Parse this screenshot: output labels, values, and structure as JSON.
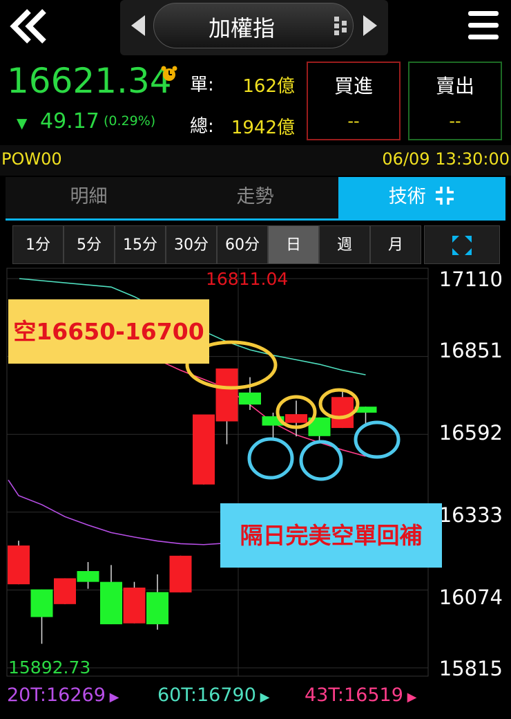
{
  "header": {
    "title": "加權指",
    "icons": [
      "double-back-chevron-icon",
      "prev-triangle-icon",
      "grid-dots-icon",
      "next-triangle-icon",
      "hamburger-menu-icon"
    ]
  },
  "quote": {
    "price": "16621.34",
    "change_arrow": "▼",
    "change": "49.17",
    "change_pct": "(0.29%)",
    "single_label": "單:",
    "single_value": "162億",
    "total_label": "總:",
    "total_value": "1942億",
    "buy_label": "買進",
    "buy_value": "--",
    "sell_label": "賣出",
    "sell_value": "--",
    "colors": {
      "up": "#e3141e",
      "down": "#2bd943",
      "accent": "#0ab4ee",
      "value_yellow": "#f0e020"
    }
  },
  "info": {
    "code": "POW00",
    "datetime": "06/09 13:30:00"
  },
  "tabs": [
    {
      "label": "明細"
    },
    {
      "label": "走勢"
    },
    {
      "label": "技術"
    }
  ],
  "periods": [
    "1分",
    "5分",
    "15分",
    "30分",
    "60分",
    "日",
    "週",
    "月"
  ],
  "selected_period": "日",
  "chart": {
    "high_label": "16811.04",
    "low_label": "15892.73",
    "y_ticks": [
      "17110",
      "16851",
      "16592",
      "16333",
      "16074",
      "15815"
    ],
    "note_short": "空16650-16700",
    "note_cover": "隔日完美空單回補",
    "ma": [
      {
        "label": "20T:16269",
        "color": "#b84fe8"
      },
      {
        "label": "60T:16790",
        "color": "#4fe0c0"
      },
      {
        "label": "43T:16519",
        "color": "#ff3d8a"
      }
    ]
  },
  "chart_data": {
    "type": "candlestick",
    "ylim": [
      15815,
      17110
    ],
    "y_ticks": [
      17110,
      16851,
      16592,
      16333,
      16074,
      15815
    ],
    "candles": [
      {
        "open": 16222,
        "close": 16093,
        "high": 16238,
        "low": 16093,
        "color": "red"
      },
      {
        "open": 15984,
        "close": 16076,
        "high": 16076,
        "low": 15895,
        "color": "green"
      },
      {
        "open": 16027,
        "close": 16113,
        "high": 16113,
        "low": 16027,
        "color": "red"
      },
      {
        "open": 16137,
        "close": 16101,
        "high": 16167,
        "low": 16078,
        "color": "green"
      },
      {
        "open": 16101,
        "close": 15960,
        "high": 16157,
        "low": 15960,
        "color": "green"
      },
      {
        "open": 15963,
        "close": 16082,
        "high": 16101,
        "low": 15963,
        "color": "red"
      },
      {
        "open": 16067,
        "close": 15960,
        "high": 16126,
        "low": 15942,
        "color": "green"
      },
      {
        "open": 16066,
        "close": 16188,
        "high": 16188,
        "low": 16066,
        "color": "red"
      },
      {
        "open": 16425,
        "close": 16658,
        "high": 16658,
        "low": 16425,
        "color": "red"
      },
      {
        "open": 16635,
        "close": 16811,
        "high": 16811,
        "low": 16559,
        "color": "red"
      },
      {
        "open": 16731,
        "close": 16691,
        "high": 16782,
        "low": 16673,
        "color": "green"
      },
      {
        "open": 16652,
        "close": 16621,
        "high": 16664,
        "low": 16580,
        "color": "green"
      },
      {
        "open": 16630,
        "close": 16659,
        "high": 16704,
        "low": 16585,
        "color": "red"
      },
      {
        "open": 16648,
        "close": 16586,
        "high": 16648,
        "low": 16564,
        "color": "green"
      },
      {
        "open": 16613,
        "close": 16716,
        "high": 16738,
        "low": 16613,
        "color": "red"
      },
      {
        "open": 16684,
        "close": 16664,
        "high": 16684,
        "low": 16621,
        "color": "green"
      }
    ],
    "ma_series": [
      {
        "name": "20T:16269",
        "values": [
          16388,
          16358,
          16318,
          16290,
          16265,
          16250,
          16237,
          16228,
          16225,
          16230,
          16238,
          16246,
          16252,
          16258,
          16264,
          16269
        ]
      },
      {
        "name": "60T:16790",
        "values": [
          null,
          null,
          null,
          null,
          17082,
          17050,
          17010,
          16970,
          16935,
          16900,
          16873,
          16855,
          16840,
          16825,
          16805,
          16790
        ]
      },
      {
        "name": "43T:16519",
        "values": [
          null,
          null,
          null,
          null,
          16906,
          16870,
          16840,
          16805,
          16775,
          16745,
          16690,
          16630,
          16590,
          16565,
          16540,
          16519
        ]
      }
    ]
  }
}
